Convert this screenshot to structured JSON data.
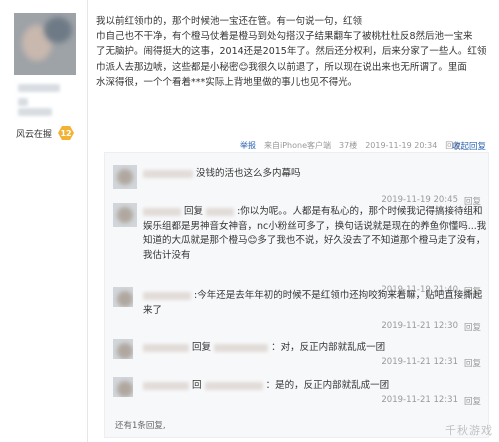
{
  "user": {
    "level_text": "风云在握",
    "level_badge": "12"
  },
  "post": {
    "lines": [
      "我以前红领巾的，那个时候池一宝还在管。有一句说一句，红领",
      "巾自己也不干净，有个橙马仗着是橙马到处勾搭汉子结果翻车了被桃杜杜反8然后池一宝来",
      "了无脑护。闹得挺大的这事，2014还是2015年了。然后还分权利，后来分家了一些人。红领",
      "巾派人去那边唬，这些都是小秘密😊我很久以前退了，所以现在说出来也无所谓了。里面",
      "水深得很，一个个看着***实际上背地里做的事儿也见不得光。"
    ],
    "report": "举报",
    "source": "来自iPhone客户端",
    "floor": "37楼",
    "time": "2019-11-19 20:34",
    "reply": "回复",
    "collapse": "收起回复"
  },
  "replies": [
    {
      "text": "没钱的活也这么多内幕吗",
      "time": "2019-11-19 20:45",
      "reply": "回复"
    },
    {
      "prefix": "回复",
      "text": ":你以为呢。。人都是有私心的，那个时候我记得搞接待组和娱乐组都是男神音女神音，nc小粉丝可多了，换句话说就是现在的养鱼你懂吗...我知道的大瓜就是那个橙马😊多了我也不说，好久没去了不知道那个橙马走了没有，我估计没有",
      "time": "2019-11-19 21:40",
      "reply": "回复"
    },
    {
      "text": ":今年还是去年年初的时候不是红领巾还拘咬狗来着嘛，贴吧直接撕起来了",
      "time": "2019-11-21 12:30",
      "reply": "回复"
    },
    {
      "prefix": "回复",
      "text": "：对，反正内部就乱成一团",
      "time": "2019-11-21 12:31",
      "reply": "回复"
    },
    {
      "prefix": "回",
      "text": "：是的，反正内部就乱成一团",
      "time": "2019-11-21 12:31",
      "reply": "回复"
    }
  ],
  "more_replies": "还有1条回复,",
  "watermark": "千秋游戏"
}
